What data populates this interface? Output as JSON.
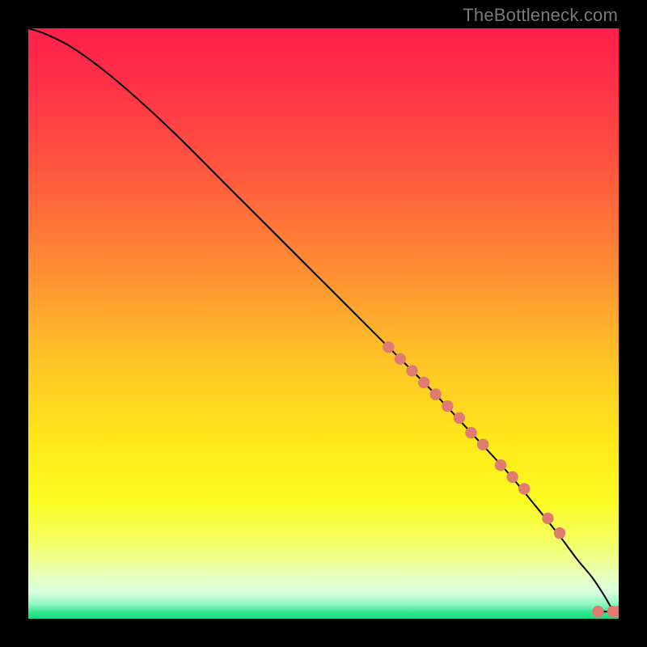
{
  "attribution": "TheBottleneck.com",
  "gradient_stops": [
    {
      "offset": 0.0,
      "color": "#ff1f4b"
    },
    {
      "offset": 0.1,
      "color": "#ff3247"
    },
    {
      "offset": 0.25,
      "color": "#ff5a3e"
    },
    {
      "offset": 0.4,
      "color": "#ff8a34"
    },
    {
      "offset": 0.55,
      "color": "#ffc027"
    },
    {
      "offset": 0.7,
      "color": "#ffe81a"
    },
    {
      "offset": 0.8,
      "color": "#fbfb20"
    },
    {
      "offset": 0.87,
      "color": "#f4ff63"
    },
    {
      "offset": 0.92,
      "color": "#eaffb0"
    },
    {
      "offset": 0.955,
      "color": "#d8ffe0"
    },
    {
      "offset": 0.975,
      "color": "#93f7c0"
    },
    {
      "offset": 0.99,
      "color": "#2ee68f"
    },
    {
      "offset": 1.0,
      "color": "#18db82"
    }
  ],
  "chart_data": {
    "type": "line",
    "title": "",
    "xlabel": "",
    "ylabel": "",
    "xlim": [
      0,
      100
    ],
    "ylim": [
      0,
      100
    ],
    "series": [
      {
        "name": "curve",
        "x": [
          0,
          3,
          7,
          12,
          18,
          25,
          33,
          42,
          51,
          60,
          68,
          75,
          81,
          86,
          90,
          93,
          95.5,
          97.5,
          99,
          100
        ],
        "y": [
          100,
          99,
          97,
          93.5,
          88.5,
          82,
          74,
          65,
          56,
          47,
          39,
          31.5,
          25,
          19,
          14,
          10,
          7,
          4,
          1.5,
          1.2
        ]
      }
    ],
    "markers": {
      "name": "cluster",
      "color": "#e07b72",
      "radius": 7.2,
      "x": [
        61,
        63,
        65,
        67,
        69,
        71,
        73,
        75,
        77,
        80,
        82,
        84,
        88,
        90,
        96.5,
        99.0,
        100
      ],
      "y": [
        46,
        44,
        42,
        40,
        38,
        36,
        34,
        31.5,
        29.5,
        26,
        24,
        22,
        17,
        14.5,
        1.2,
        1.2,
        1.2
      ]
    }
  }
}
